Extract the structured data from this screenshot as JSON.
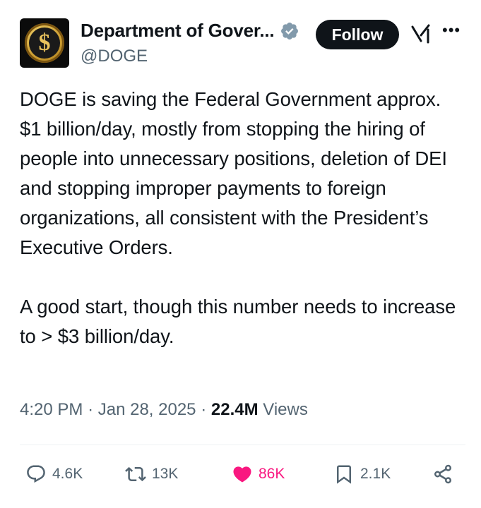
{
  "author": {
    "display_name": "Department of Gover...",
    "handle": "@DOGE",
    "verified_icon": "verified-badge-icon",
    "avatar_icon": "dollar-coin-icon"
  },
  "header": {
    "follow_label": "Follow",
    "grok_icon": "grok-icon",
    "more_icon": "more-options-icon"
  },
  "tweet": {
    "text": "DOGE is saving the Federal Government approx. $1 billion/day, mostly from stopping the hiring of people into unnecessary positions, deletion of DEI and stopping improper payments to foreign organizations, all consistent with the President’s Executive Orders.\n\nA good start, though this number needs to increase to > $3 billion/day.",
    "time": "4:20 PM",
    "separator": "·",
    "date": "Jan 28, 2025",
    "views_count": "22.4M",
    "views_label": "Views"
  },
  "actions": {
    "replies": "4.6K",
    "reposts": "13K",
    "likes": "86K",
    "bookmarks": "2.1K"
  },
  "colors": {
    "text": "#0f1419",
    "secondary": "#536471",
    "like": "#f91880",
    "verified": "#829aab",
    "follow_bg": "#0f1419"
  }
}
